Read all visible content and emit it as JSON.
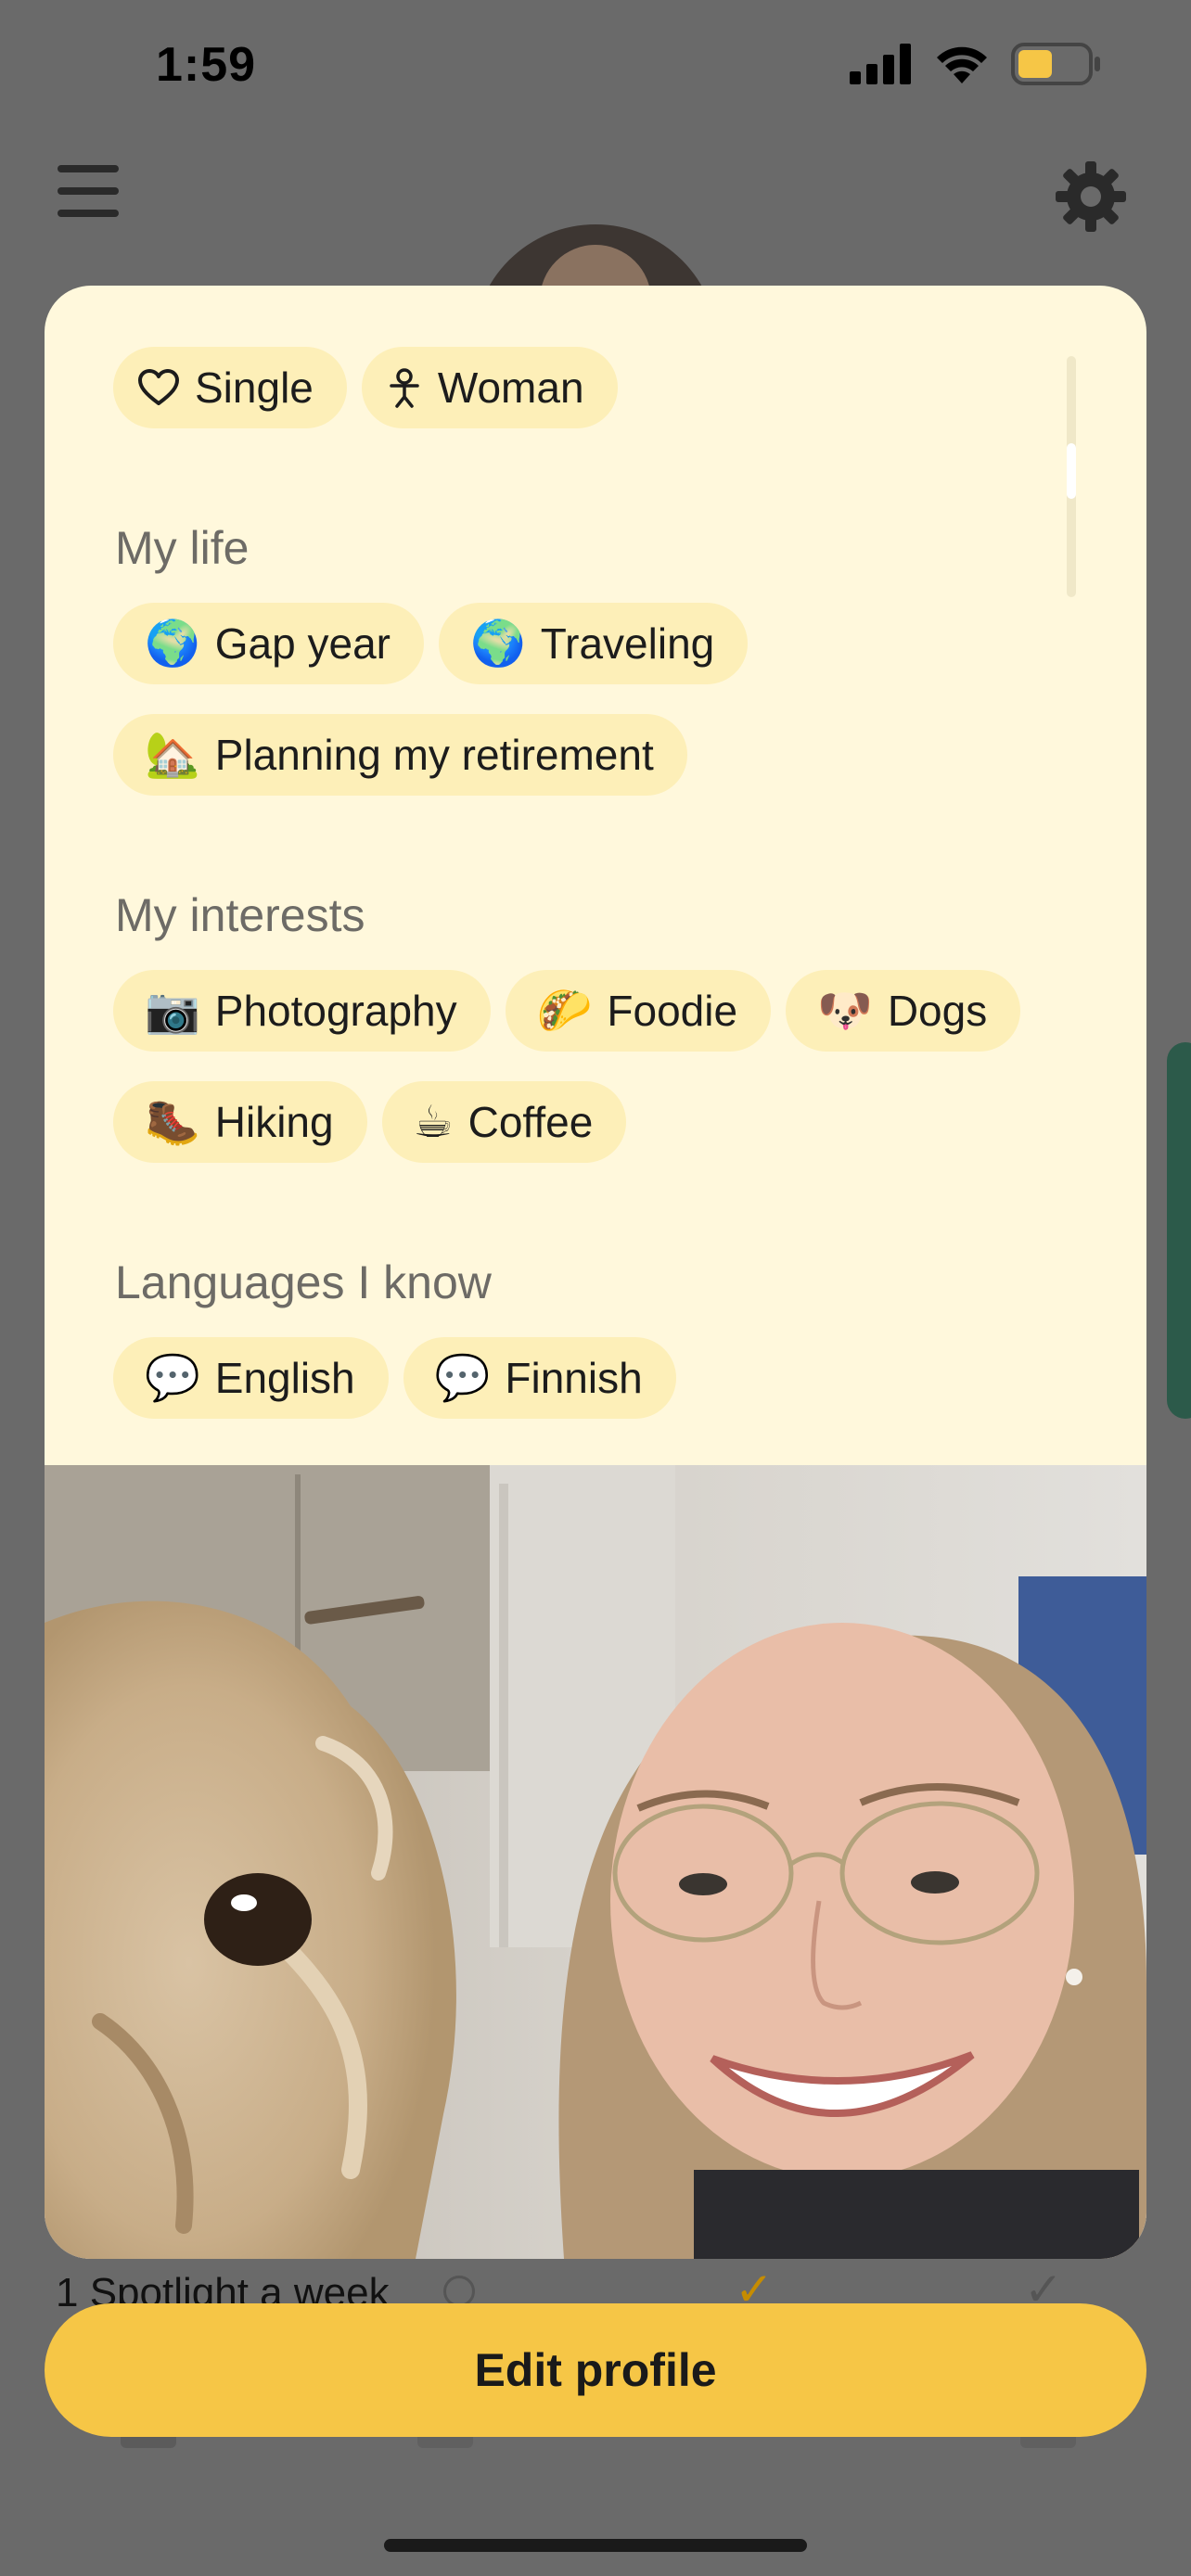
{
  "status_bar": {
    "time": "1:59"
  },
  "profile_card": {
    "basics": [
      {
        "icon": "heart-icon",
        "glyph": "♡",
        "label": "Single"
      },
      {
        "icon": "person-icon",
        "glyph": "♀",
        "label": "Woman"
      }
    ],
    "my_life": {
      "title": "My life",
      "items": [
        {
          "icon": "globe-icon",
          "glyph": "🌍",
          "label": "Gap year"
        },
        {
          "icon": "globe-icon",
          "glyph": "🌍",
          "label": "Traveling"
        },
        {
          "icon": "house-icon",
          "glyph": "🏡",
          "label": "Planning my retirement"
        }
      ]
    },
    "my_interests": {
      "title": "My interests",
      "items": [
        {
          "icon": "camera-icon",
          "glyph": "📷",
          "label": "Photography"
        },
        {
          "icon": "taco-icon",
          "glyph": "🌮",
          "label": "Foodie"
        },
        {
          "icon": "dog-icon",
          "glyph": "🐶",
          "label": "Dogs"
        },
        {
          "icon": "boot-icon",
          "glyph": "🥾",
          "label": "Hiking"
        },
        {
          "icon": "coffee-icon",
          "glyph": "☕",
          "label": "Coffee"
        }
      ]
    },
    "languages": {
      "title": "Languages I know",
      "items": [
        {
          "icon": "speech-bubble-icon",
          "glyph": "💬",
          "label": "English"
        },
        {
          "icon": "speech-bubble-icon",
          "glyph": "💬",
          "label": "Finnish"
        }
      ]
    }
  },
  "behind": {
    "spotlight_text": "1 Spotlight a week",
    "check_glyph": "✓"
  },
  "edit_button": {
    "label": "Edit profile"
  },
  "colors": {
    "chip": "#fdefb8",
    "card": "#fff8dc",
    "button": "#f6c646",
    "overlay": "#6a6a6a"
  }
}
